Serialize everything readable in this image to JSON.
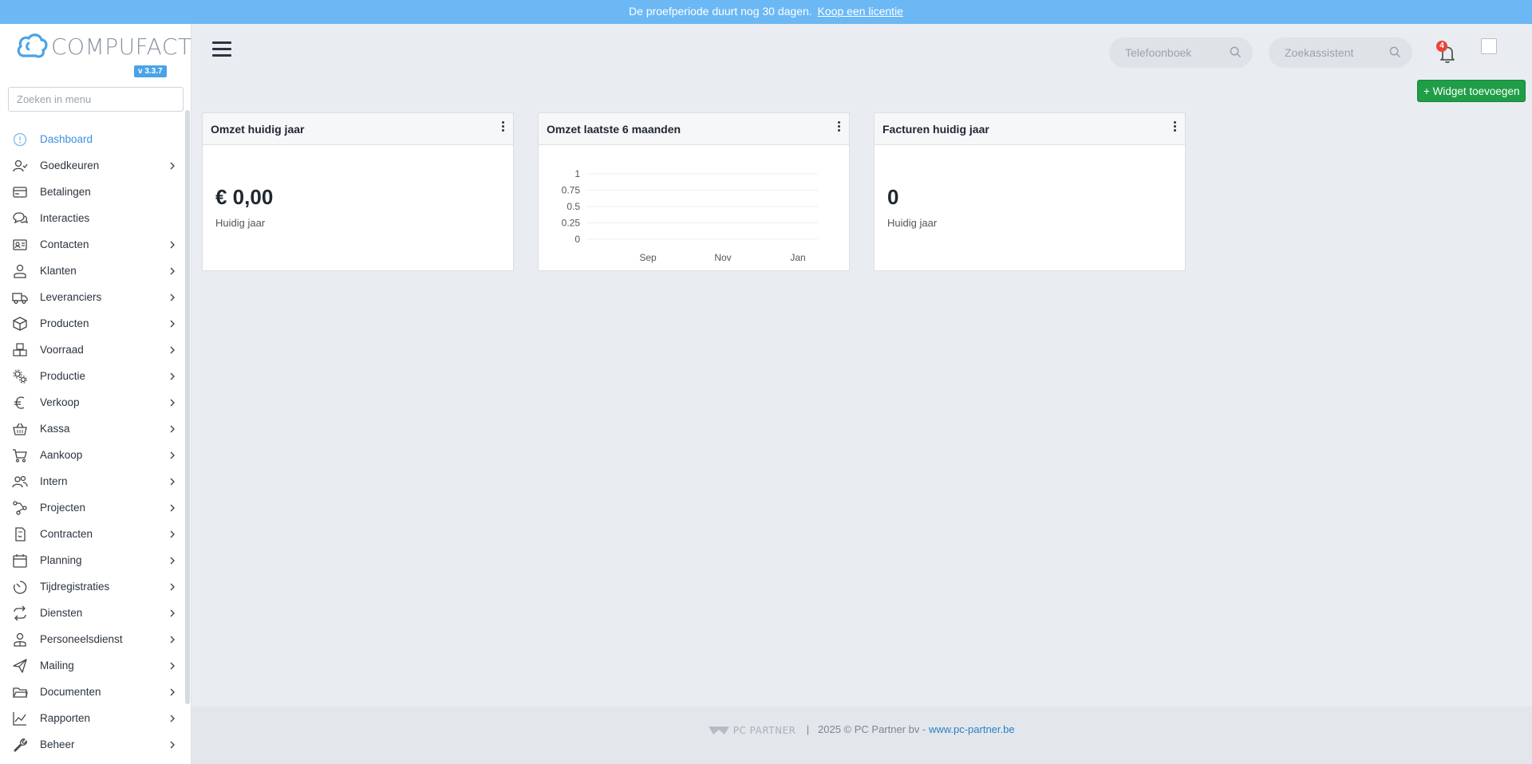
{
  "banner": {
    "text": "De proefperiode duurt nog 30 dagen.",
    "link": "Koop een licentie"
  },
  "app": {
    "name": "COMPUFACT",
    "version": "v 3.3.7"
  },
  "sidebar": {
    "search_placeholder": "Zoeken in menu",
    "items": [
      {
        "label": "Dashboard",
        "icon": "dashboard-icon",
        "active": true,
        "chevron": false
      },
      {
        "label": "Goedkeuren",
        "icon": "user-check-icon",
        "chevron": true
      },
      {
        "label": "Betalingen",
        "icon": "credit-card-icon",
        "chevron": false
      },
      {
        "label": "Interacties",
        "icon": "chat-bubbles-icon",
        "chevron": false
      },
      {
        "label": "Contacten",
        "icon": "contact-card-icon",
        "chevron": true
      },
      {
        "label": "Klanten",
        "icon": "customer-icon",
        "chevron": true
      },
      {
        "label": "Leveranciers",
        "icon": "truck-icon",
        "chevron": true
      },
      {
        "label": "Producten",
        "icon": "box-icon",
        "chevron": true
      },
      {
        "label": "Voorraad",
        "icon": "boxes-icon",
        "chevron": true
      },
      {
        "label": "Productie",
        "icon": "gears-icon",
        "chevron": true
      },
      {
        "label": "Verkoop",
        "icon": "euro-icon",
        "chevron": true
      },
      {
        "label": "Kassa",
        "icon": "basket-icon",
        "chevron": true
      },
      {
        "label": "Aankoop",
        "icon": "cart-icon",
        "chevron": true
      },
      {
        "label": "Intern",
        "icon": "users-icon",
        "chevron": true
      },
      {
        "label": "Projecten",
        "icon": "project-tree-icon",
        "chevron": true
      },
      {
        "label": "Contracten",
        "icon": "contract-icon",
        "chevron": true
      },
      {
        "label": "Planning",
        "icon": "calendar-icon",
        "chevron": true
      },
      {
        "label": "Tijdregistraties",
        "icon": "stopwatch-icon",
        "chevron": true
      },
      {
        "label": "Diensten",
        "icon": "repeat-icon",
        "chevron": true
      },
      {
        "label": "Personeelsdienst",
        "icon": "person-badge-icon",
        "chevron": true
      },
      {
        "label": "Mailing",
        "icon": "paper-plane-icon",
        "chevron": true
      },
      {
        "label": "Documenten",
        "icon": "folder-icon",
        "chevron": true
      },
      {
        "label": "Rapporten",
        "icon": "line-chart-icon",
        "chevron": true
      },
      {
        "label": "Beheer",
        "icon": "wrench-icon",
        "chevron": true
      }
    ]
  },
  "header": {
    "phonebook_placeholder": "Telefoonboek",
    "assistant_placeholder": "Zoekassistent",
    "notifications_count": "4"
  },
  "actions": {
    "add_widget": "+ Widget toevoegen"
  },
  "widgets": [
    {
      "title": "Omzet huidig jaar",
      "value": "€ 0,00",
      "subtitle": "Huidig jaar"
    },
    {
      "title": "Omzet laatste 6 maanden"
    },
    {
      "title": "Facturen huidig jaar",
      "value": "0",
      "subtitle": "Huidig jaar"
    }
  ],
  "chart_data": {
    "type": "line",
    "title": "Omzet laatste 6 maanden",
    "y_ticks": [
      "1",
      "0.75",
      "0.5",
      "0.25",
      "0"
    ],
    "ylim": [
      0,
      1
    ],
    "x_tick_labels": [
      "Sep",
      "Nov",
      "Jan"
    ],
    "series": [],
    "grid": true
  },
  "footer": {
    "logo": "PC PARTNER",
    "text": "2025 © PC Partner bv -",
    "link": "www.pc-partner.be"
  },
  "colors": {
    "banner": "#6bb8f5",
    "accent": "#3a8fe0",
    "add_button": "#1f9d47",
    "badge": "#e8453c"
  }
}
